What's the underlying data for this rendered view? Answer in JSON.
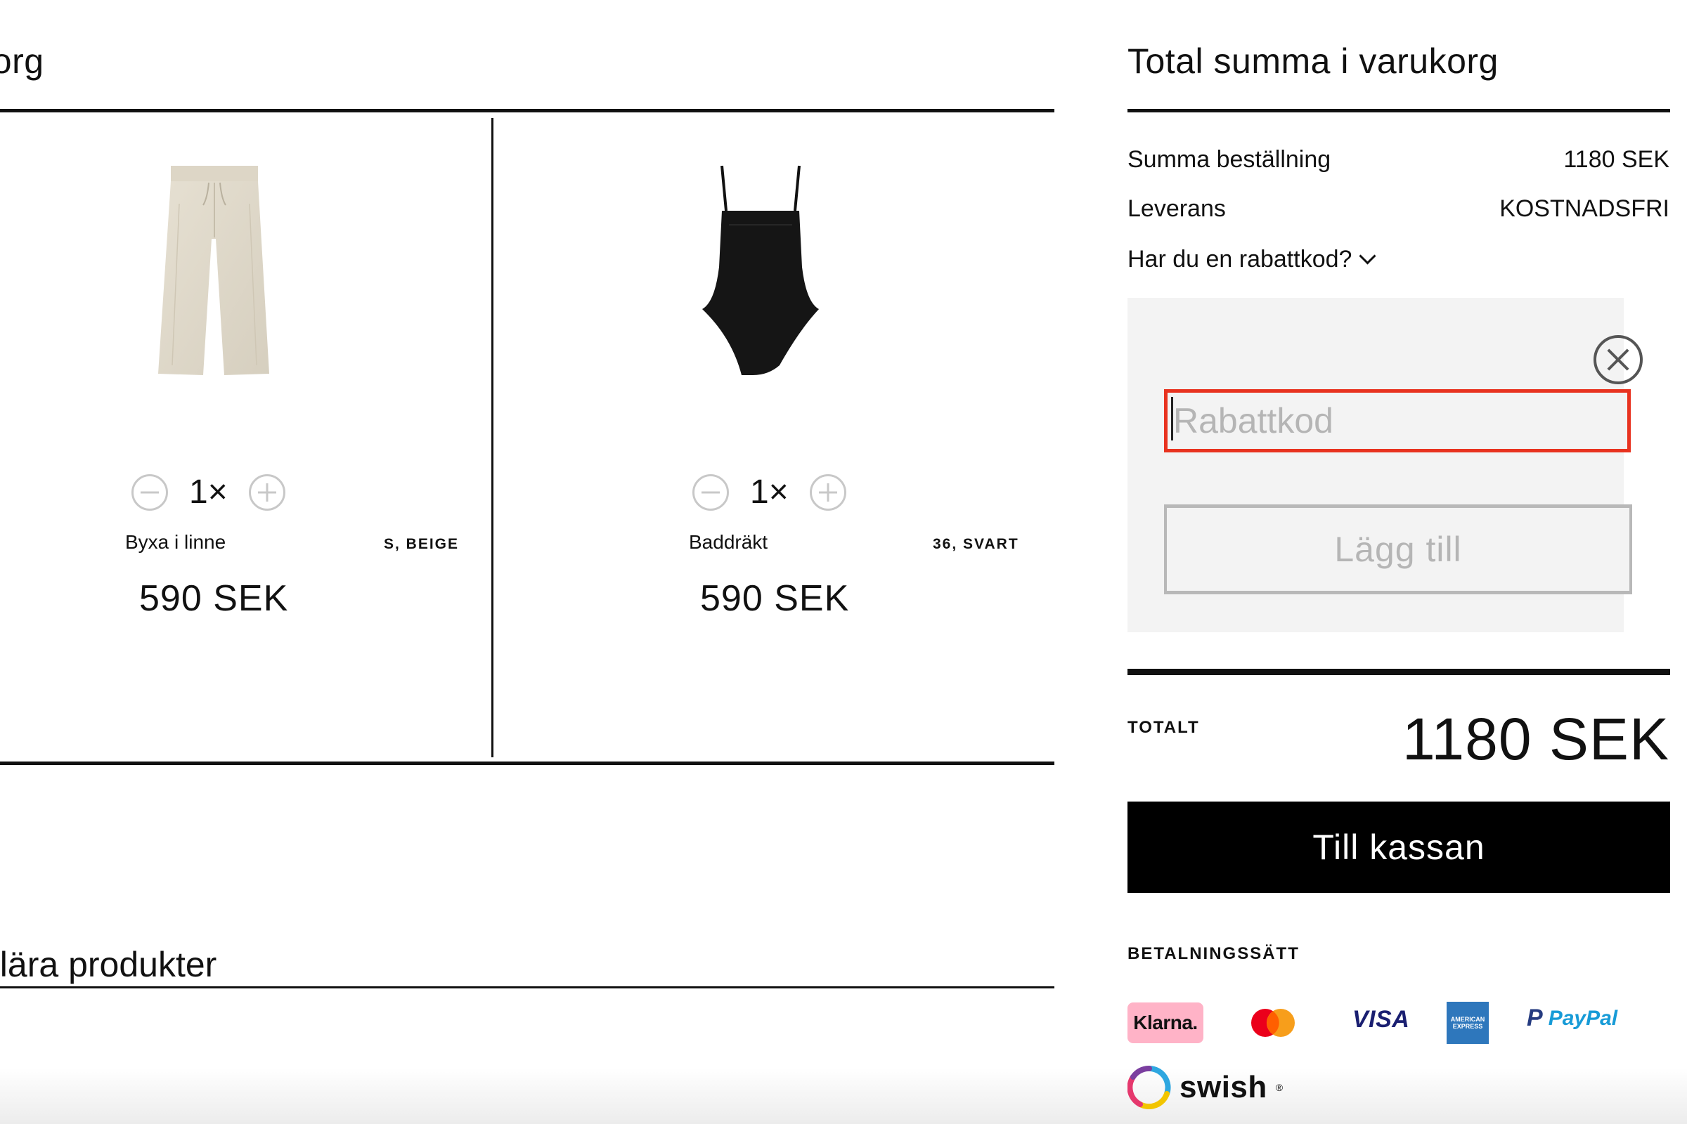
{
  "cart": {
    "title": "Varukorg",
    "title_visible": "ukorg",
    "items": [
      {
        "image": "beige-linen-trousers",
        "quantity": "1×",
        "name": "Byxa i linne",
        "variant": "S, BEIGE",
        "price": "590 SEK"
      },
      {
        "image": "black-swimsuit",
        "quantity": "1×",
        "name": "Baddräkt",
        "variant": "36, SVART",
        "price": "590 SEK"
      }
    ],
    "icons": {
      "decrease": "minus-circle-icon",
      "increase": "plus-circle-icon"
    }
  },
  "popular": {
    "title_visible": "ulära produkter"
  },
  "summary": {
    "title": "Total summa i varukorg",
    "order_sum_label": "Summa beställning",
    "order_sum_value": "1180 SEK",
    "delivery_label": "Leverans",
    "delivery_value": "KOSTNADSFRI",
    "discount_toggle": "Har du en rabattkod?",
    "discount": {
      "placeholder": "Rabattkod",
      "value": "",
      "add_button": "Lägg till",
      "close_icon": "close-circle-icon"
    },
    "total_label": "TOTALT",
    "total_value": "1180 SEK",
    "checkout_button": "Till kassan",
    "payment_label": "BETALNINGSSÄTT",
    "payment_methods": {
      "klarna": "Klarna.",
      "mastercard": "mastercard-logo",
      "visa": "VISA",
      "amex": "AMERICAN EXPRESS",
      "paypal": "PayPal",
      "swish": "swish"
    }
  },
  "colors": {
    "text": "#111111",
    "highlight_border": "#e8321f",
    "panel_bg": "#f3f3f3",
    "checkout_bg": "#000000",
    "klarna_pink": "#ffb3c7"
  }
}
